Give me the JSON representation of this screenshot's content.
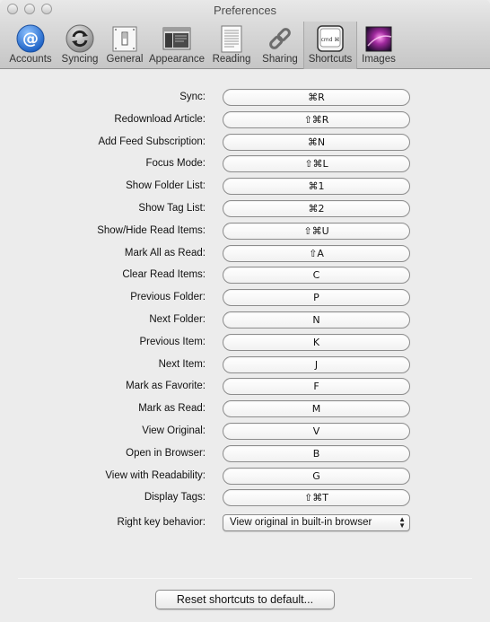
{
  "window": {
    "title": "Preferences"
  },
  "toolbar": {
    "tabs": [
      {
        "label": "Accounts",
        "icon": "at-sign-icon",
        "selected": false
      },
      {
        "label": "Syncing",
        "icon": "sync-arrows-icon",
        "selected": false
      },
      {
        "label": "General",
        "icon": "light-switch-icon",
        "selected": false
      },
      {
        "label": "Appearance",
        "icon": "appearance-window-icon",
        "selected": false
      },
      {
        "label": "Reading",
        "icon": "document-page-icon",
        "selected": false
      },
      {
        "label": "Sharing",
        "icon": "chain-link-icon",
        "selected": false
      },
      {
        "label": "Shortcuts",
        "icon": "keyboard-key-icon",
        "selected": true
      },
      {
        "label": "Images",
        "icon": "image-galaxy-icon",
        "selected": false
      }
    ]
  },
  "shortcuts": [
    {
      "label": "Sync:",
      "key": "⌘R"
    },
    {
      "label": "Redownload Article:",
      "key": "⇧⌘R"
    },
    {
      "label": "Add Feed Subscription:",
      "key": "⌘N"
    },
    {
      "label": "Focus Mode:",
      "key": "⇧⌘L"
    },
    {
      "label": "Show Folder List:",
      "key": "⌘1"
    },
    {
      "label": "Show Tag List:",
      "key": "⌘2"
    },
    {
      "label": "Show/Hide Read Items:",
      "key": "⇧⌘U"
    },
    {
      "label": "Mark All as Read:",
      "key": "⇧A"
    },
    {
      "label": "Clear Read Items:",
      "key": "C"
    },
    {
      "label": "Previous Folder:",
      "key": "P"
    },
    {
      "label": "Next Folder:",
      "key": "N"
    },
    {
      "label": "Previous Item:",
      "key": "K"
    },
    {
      "label": "Next Item:",
      "key": "J"
    },
    {
      "label": "Mark as Favorite:",
      "key": "F"
    },
    {
      "label": "Mark as Read:",
      "key": "M"
    },
    {
      "label": "View Original:",
      "key": "V"
    },
    {
      "label": "Open in Browser:",
      "key": "B"
    },
    {
      "label": "View with Readability:",
      "key": "G"
    },
    {
      "label": "Display Tags:",
      "key": "⇧⌘T"
    }
  ],
  "right_key": {
    "label": "Right key behavior:",
    "value": "View original in built-in browser"
  },
  "reset_button": "Reset shortcuts to default...",
  "colors": {
    "accent": "#2f7fd8",
    "toolbar_selected": "#c4c4c4"
  }
}
